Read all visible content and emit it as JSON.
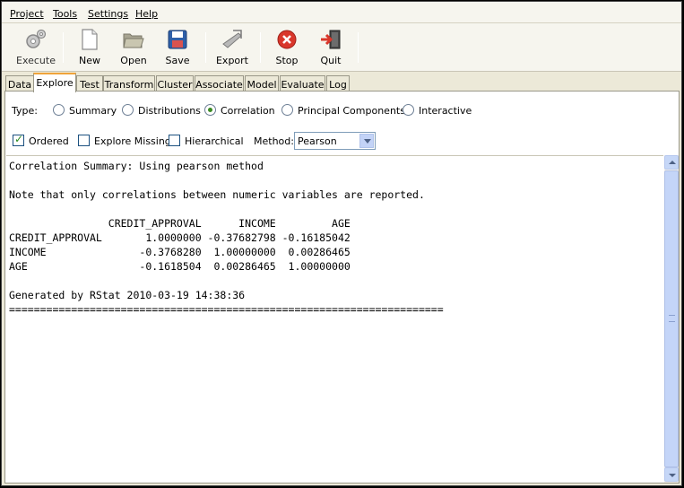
{
  "menu": [
    {
      "label": "Project"
    },
    {
      "label": "Tools"
    },
    {
      "label": "Settings"
    },
    {
      "label": "Help"
    }
  ],
  "toolbar": {
    "execute": "Execute",
    "new": "New",
    "open": "Open",
    "save": "Save",
    "export": "Export",
    "stop": "Stop",
    "quit": "Quit"
  },
  "tabs": [
    "Data",
    "Explore",
    "Test",
    "Transform",
    "Cluster",
    "Associate",
    "Model",
    "Evaluate",
    "Log"
  ],
  "active_tab": "Explore",
  "type_row": {
    "label": "Type:",
    "options": [
      "Summary",
      "Distributions",
      "Correlation",
      "Principal Components",
      "Interactive"
    ],
    "selected": "Correlation"
  },
  "options_row": {
    "ordered": "Ordered",
    "ordered_checked": true,
    "explore_missing": "Explore Missing",
    "explore_missing_checked": false,
    "hierarchical": "Hierarchical",
    "hierarchical_checked": false,
    "method_label": "Method:",
    "method_value": "Pearson"
  },
  "output": {
    "line1": "Correlation Summary: Using pearson method",
    "line2": "",
    "line3": "Note that only correlations between numeric variables are reported.",
    "line4": "",
    "line5": "                CREDIT_APPROVAL      INCOME         AGE",
    "line6": "CREDIT_APPROVAL       1.0000000 -0.37682798 -0.16185042",
    "line7": "INCOME               -0.3768280  1.00000000  0.00286465",
    "line8": "AGE                  -0.1618504  0.00286465  1.00000000",
    "line9": "",
    "line10": "Generated by RStat 2010-03-19 14:38:36",
    "line11": "======================================================================"
  },
  "colors": {
    "active_tab_accent": "#f0a43a",
    "stop_red": "#d9372b",
    "window_bg": "#ece9d8"
  }
}
